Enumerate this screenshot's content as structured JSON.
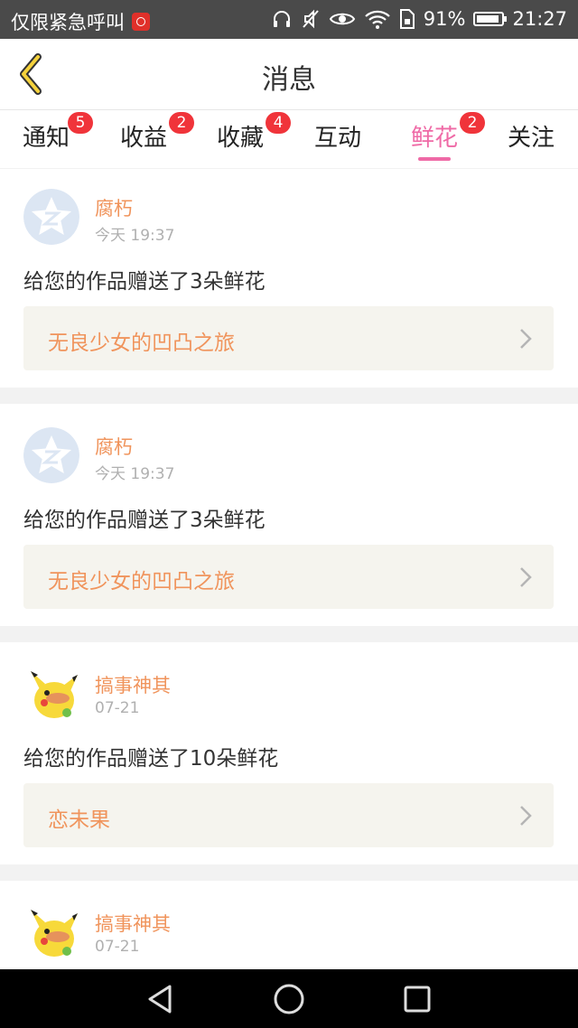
{
  "status_bar": {
    "carrier_text": "仅限紧急呼叫",
    "battery": "91%",
    "time": "21:27",
    "icons": [
      "netease-app-icon",
      "headphones-icon",
      "mute-icon",
      "eye-icon",
      "wifi-icon",
      "sim-icon",
      "battery-icon"
    ]
  },
  "header": {
    "title": "消息",
    "back_icon": "chevron-left-icon"
  },
  "tabs": [
    {
      "label": "通知",
      "badge": "5"
    },
    {
      "label": "收益",
      "badge": "2"
    },
    {
      "label": "收藏",
      "badge": "4"
    },
    {
      "label": "互动",
      "badge": ""
    },
    {
      "label": "鲜花",
      "badge": "2",
      "active": true
    },
    {
      "label": "关注",
      "badge": ""
    }
  ],
  "messages": [
    {
      "user": "腐朽",
      "time": "今天 19:37",
      "text": "给您的作品赠送了3朵鲜花",
      "work": "无良少女的凹凸之旅",
      "avatar": "default-star-avatar"
    },
    {
      "user": "腐朽",
      "time": "今天 19:37",
      "text": "给您的作品赠送了3朵鲜花",
      "work": "无良少女的凹凸之旅",
      "avatar": "default-star-avatar"
    },
    {
      "user": "搞事神其",
      "time": "07-21",
      "text": "给您的作品赠送了10朵鲜花",
      "work": "恋未果",
      "avatar": "pikachu-avatar"
    },
    {
      "user": "搞事神其",
      "time": "07-21",
      "avatar": "pikachu-avatar"
    }
  ],
  "colors": {
    "accent": "#ef6aa6",
    "name": "#f0945c",
    "badge": "#f0343a",
    "work_bg": "#f5f4ee"
  },
  "nav_icons": [
    "back-triangle-icon",
    "home-circle-icon",
    "recents-square-icon"
  ]
}
